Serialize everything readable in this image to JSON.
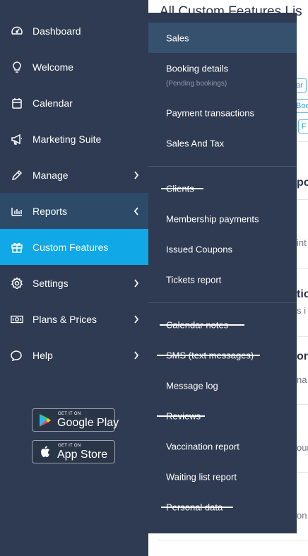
{
  "background_page": {
    "title": "All Custom Features Lis",
    "chips": [
      "ar",
      "Boo",
      "F"
    ],
    "fragments": [
      "po",
      "int",
      "tio",
      "s i",
      "ori",
      "na",
      "our",
      "on y"
    ]
  },
  "sidebar": {
    "items": [
      {
        "label": "Dashboard",
        "icon": "dashboard-icon"
      },
      {
        "label": "Welcome",
        "icon": "lightbulb-icon"
      },
      {
        "label": "Calendar",
        "icon": "calendar-icon"
      },
      {
        "label": "Marketing Suite",
        "icon": "megaphone-icon"
      },
      {
        "label": "Manage",
        "icon": "pencil-icon"
      },
      {
        "label": "Reports",
        "icon": "bar-chart-icon"
      },
      {
        "label": "Custom Features",
        "icon": "gift-icon"
      },
      {
        "label": "Settings",
        "icon": "gear-icon"
      },
      {
        "label": "Plans & Prices",
        "icon": "money-icon"
      },
      {
        "label": "Help",
        "icon": "speech-bubble-icon"
      }
    ],
    "stores": [
      {
        "small": "GET IT ON",
        "big": "Google Play",
        "icon": "google-play-icon"
      },
      {
        "small": "GET IT ON",
        "big": "App Store",
        "icon": "apple-icon"
      }
    ]
  },
  "submenu": {
    "items": [
      {
        "label": "Sales"
      },
      {
        "label": "Booking details",
        "sub": "(Pending bookings)"
      },
      {
        "label": "Payment transactions"
      },
      {
        "label": "Sales And Tax"
      },
      {
        "label": "Clients"
      },
      {
        "label": "Membership payments"
      },
      {
        "label": "Issued Coupons"
      },
      {
        "label": "Tickets report"
      },
      {
        "label": "Calendar notes"
      },
      {
        "label": "SMS (text messages)"
      },
      {
        "label": "Message log"
      },
      {
        "label": "Reviews"
      },
      {
        "label": "Vaccination report"
      },
      {
        "label": "Waiting list report"
      },
      {
        "label": "Personal data"
      }
    ]
  },
  "colors": {
    "sidebar_bg": "#2f3b52",
    "reports_bg": "#2d4b69",
    "active_bg": "#10a8e6",
    "submenu_highlight": "#36516e"
  }
}
